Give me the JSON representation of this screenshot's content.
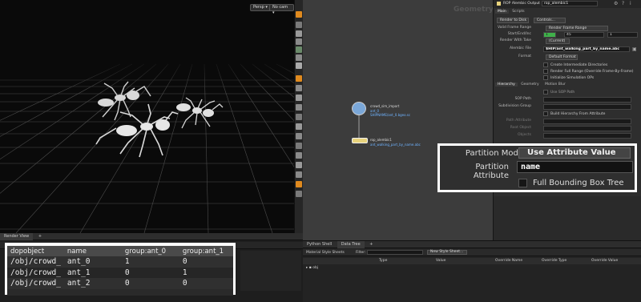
{
  "viewport": {
    "camera_label": "Persp",
    "display_label": "No cam"
  },
  "left_pane_tabs": [
    "Render View"
  ],
  "spreadsheet": {
    "columns": [
      "dopobject",
      "name",
      "group:ant_0",
      "group:ant_1"
    ],
    "rows": [
      [
        "/obj/crowd_",
        "ant_0",
        "1",
        "0"
      ],
      [
        "/obj/crowd_",
        "ant_1",
        "0",
        "1"
      ],
      [
        "/obj/crowd_",
        "ant_2",
        "0",
        "0"
      ]
    ]
  },
  "network": {
    "context_label": "Geometry",
    "node1_name": "crowd_sim_import",
    "node1_sub1": "ant_0",
    "node1_sub2": "SHIPNAME/ant_0.bgeo.sc",
    "node2_name": "rop_alembic1",
    "node2_sub": "ant_walking_part_by_name.abc"
  },
  "params": {
    "header_type": "ROP Alembic Output",
    "header_name": "rop_alembic1",
    "top_tabs": [
      "Main",
      "Scripts"
    ],
    "render_to_disk": "Render to Disk",
    "controls": "Controls...",
    "valid_frame_range_label": "Valid Frame Range",
    "valid_frame_range_value": "Render Frame Range",
    "start_end_label": "Start/End/Inc",
    "start_value": "1",
    "end_value": "45",
    "inc_value": "1",
    "render_with_take_label": "Render With Take",
    "render_with_take_value": "(Current)",
    "alembic_file_label": "Alembic File",
    "alembic_file_value": "$HIP/ant_walking_part_by_name.abc",
    "format_label": "Format",
    "format_value": "Default Format",
    "chk1": "Create Intermediate Directories",
    "chk2": "Render Full Range (Override Frame-By-Frame)",
    "chk3": "Initialize Simulation OPs",
    "sub_tabs": [
      "Hierarchy",
      "Geometry",
      "Motion Blur"
    ],
    "use_sop_path": "Use SOP Path",
    "sop_path_label": "SOP Path",
    "subdivision_group_label": "Subdivision Group",
    "build_hierarchy": "Build Hierarchy From Attribute",
    "path_attribute_label": "Path Attribute",
    "root_object_label": "Root Object",
    "objects_label": "Objects"
  },
  "zoom_panel": {
    "partition_mode_label": "Partition Mode",
    "partition_mode_value": "Use Attribute Value",
    "partition_attribute_label": "Partition Attribute",
    "partition_attribute_value": "name",
    "full_bounding_box": "Full Bounding Box Tree"
  },
  "right_pane": {
    "tabs": [
      "Python Shell",
      "Data Tree"
    ],
    "filter_label": "Filter:",
    "new_style_sheet": "New Style Sheet...",
    "style_label": "Material Style Sheets",
    "columns": [
      "Type",
      "Value",
      "Override Name",
      "Override Type",
      "Override Value"
    ],
    "row_label": "obj"
  },
  "colors": {
    "grid": "#5a5a5a",
    "node_blue": "#7aa7d8",
    "node_yellow": "#e8d37c",
    "node_text": "#6fb3ff",
    "accent_green": "#3fb04a"
  }
}
